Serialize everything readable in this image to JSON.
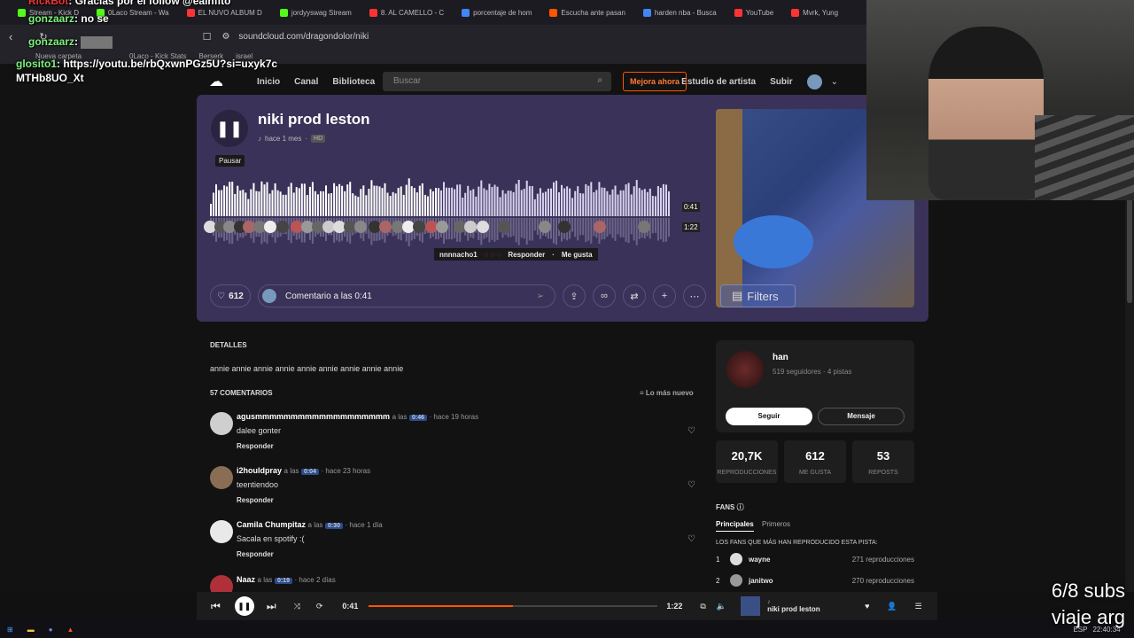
{
  "browser": {
    "tabs": [
      {
        "label": "Stream - Kick D",
        "color": "#53fc18"
      },
      {
        "label": "0Laco Stream - Wa",
        "color": "#53fc18"
      },
      {
        "label": "EL NUVO ALBUM D",
        "color": "#ff3333"
      },
      {
        "label": "jordyyswag Stream",
        "color": "#53fc18"
      },
      {
        "label": "8. AL CAMELLO - C",
        "color": "#ff3333"
      },
      {
        "label": "porcentaje de hom",
        "color": "#4285f4"
      },
      {
        "label": "Escucha ante pasan",
        "color": "#ff5500"
      },
      {
        "label": "harden nba - Busca",
        "color": "#4285f4"
      },
      {
        "label": "YouTube",
        "color": "#ff3333"
      },
      {
        "label": "Mvrk, Yung",
        "color": "#ff3333"
      }
    ],
    "url": "soundcloud.com/dragondolor/niki",
    "bookmarks": [
      "Nueva carpeta",
      "0Laco - Kick Stats",
      "Berserk",
      "israel"
    ]
  },
  "chat": {
    "line1_user": "RickBot",
    "line1_text": "Gracias por el follow @eainfito",
    "line2_user": "gonzaarz",
    "line2_text": "no se",
    "line3_user": "gonzaarz",
    "line4_user": "glosito1",
    "line4_text": "https://youtu.be/rbQxwnPGz5U?si=uxyk7cMTHb8UO_Xt"
  },
  "header": {
    "nav": [
      "Inicio",
      "Canal",
      "Biblioteca"
    ],
    "search_placeholder": "Buscar",
    "upgrade": "Mejora ahora",
    "studio": "Estudio de artista",
    "upload": "Subir"
  },
  "track": {
    "title": "niki prod leston",
    "ago": "hace 1 mes",
    "quality": "HD",
    "pause_tooltip": "Pausar",
    "current_time": "0:41",
    "duration": "1:22",
    "progress": 0.5,
    "likes": "612",
    "comment_placeholder": "Comentario a las 0:41",
    "filters_label": "Filters"
  },
  "popup": {
    "user": "nnnnacho1",
    "reply": "Responder",
    "like": "Me gusta"
  },
  "details": {
    "heading": "DETALLES",
    "description": "annie annie annie annie annie annie annie annie annie",
    "comments_heading": "57 COMENTARIOS",
    "sort_label": "Lo más nuevo"
  },
  "comments": [
    {
      "user": "agusmmmmmmmmmmmmmmmmmmm",
      "at": "a las",
      "ts": "0:46",
      "ago": "· hace 19 horas",
      "text": "dalee gonter",
      "reply": "Responder",
      "avatar_color": "#cfcfcf"
    },
    {
      "user": "i2houldpray",
      "at": "a las",
      "ts": "0:04",
      "ago": "· hace 23 horas",
      "text": "teentiendoo",
      "reply": "Responder",
      "avatar_color": "#8a6d55"
    },
    {
      "user": "Camila Chumpitaz",
      "at": "a las",
      "ts": "0:30",
      "ago": "· hace 1 día",
      "text": "Sacala en spotify :(",
      "reply": "Responder",
      "avatar_color": "#e9e9e9"
    },
    {
      "user": "Naaz",
      "at": "a las",
      "ts": "0:19",
      "ago": "· hace 2 días",
      "text": "",
      "reply": "",
      "avatar_color": "#b0303a"
    }
  ],
  "artist": {
    "name": "han",
    "meta": "519 seguidores · 4 pistas",
    "follow": "Seguir",
    "message": "Mensaje"
  },
  "stats": [
    {
      "value": "20,7K",
      "label": "REPRODUCCIONES"
    },
    {
      "value": "612",
      "label": "ME GUSTA"
    },
    {
      "value": "53",
      "label": "REPOSTS"
    }
  ],
  "fans": {
    "heading": "FANS",
    "tabs": [
      "Principales",
      "Primeros"
    ],
    "subheading": "LOS FANS QUE MÁS HAN REPRODUCIDO ESTA PISTA:",
    "list": [
      {
        "rank": "1",
        "name": "wayne",
        "plays": "271 reproducciones"
      },
      {
        "rank": "2",
        "name": "janitwo",
        "plays": "270 reproducciones"
      }
    ]
  },
  "player": {
    "current": "0:41",
    "duration": "1:22",
    "progress": 0.5,
    "track_title": "niki prod leston",
    "track_artist": "♪"
  },
  "taskbar": {
    "lang": "ESP",
    "clock": "22:40:34"
  },
  "overlay": {
    "subs_line1": "6/8 subs",
    "subs_line2": "viaje arg"
  }
}
